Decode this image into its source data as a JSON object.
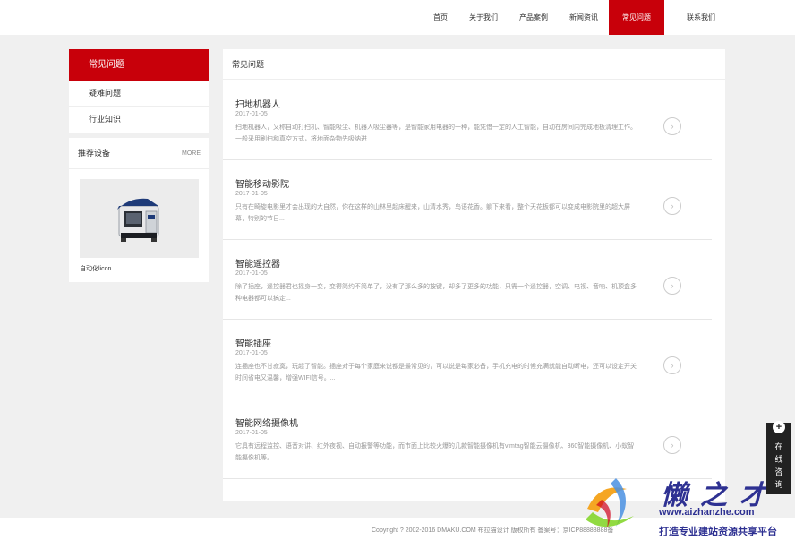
{
  "nav": {
    "items": [
      "首页",
      "关于我们",
      "产品案例",
      "新闻资讯",
      "常见问题"
    ],
    "contact": "联系我们",
    "active_index": 4
  },
  "sidebar": {
    "title": "常见问题",
    "items": [
      "疑难问题",
      "行业知识"
    ]
  },
  "recommend": {
    "title": "推荐设备",
    "more": "MORE",
    "caption": "自动化licon"
  },
  "main": {
    "title": "常见问题",
    "articles": [
      {
        "title": "扫地机器人",
        "date": "2017-01-05",
        "desc": "扫地机器人，又称自动打扫机、智能吸尘、机器人吸尘器等，是智能家用电器的一种，能凭借一定的人工智能，自动在房间内完成地板清理工作。一般采用刷扫和真空方式，将地面杂物先吸纳进"
      },
      {
        "title": "智能移动影院",
        "date": "2017-01-05",
        "desc": "只有在畸旋电影里才会出现的大自然，你在这样的山林里起床醒来，山清水秀，鸟语花香。躺下来看，整个天花板都可以变成电影院里的超大屏幕，特别的节日..."
      },
      {
        "title": "智能遥控器",
        "date": "2017-01-05",
        "desc": "除了插座，遥控器君也摇身一变，变得简约不简单了，没有了那么多的按键，却多了更多的功能，只需一个遥控器，空调、电视、音响、机顶盒多种电器都可以搞定..."
      },
      {
        "title": "智能插座",
        "date": "2017-01-05",
        "desc": "连插座也不甘寂寞，玩起了智能。插座对于每个家庭来说都是最常见的，可以说是每家必备，手机充电的时候充满就能自动断电，还可以设定开关时间省电又温馨，增强WIFI信号。..."
      },
      {
        "title": "智能网络摄像机",
        "date": "2017-01-05",
        "desc": "它具有远程监控、语音对讲、红外夜视、自动报警等功能，而市面上比较火爆的几款智能摄像机有vimtag智能云摄像机、360智能摄像机、小蚁智能摄像机等。..."
      }
    ]
  },
  "footer": {
    "copyright": "Copyright ? 2002-2016 DMAKU.COM 布拉猫设计 版权所有 备案号：京ICP88888888备"
  },
  "chat": {
    "label": "在线咨询"
  },
  "watermark": {
    "brand": "懒之才",
    "url": "www.aizhanzhe.com",
    "slogan": "打造专业建站资源共享平台"
  },
  "colors": {
    "accent": "#c8000a",
    "watermark": "#2e3192"
  },
  "icons": {
    "arrow": "chevron-right-icon",
    "chat": "plus-icon"
  }
}
